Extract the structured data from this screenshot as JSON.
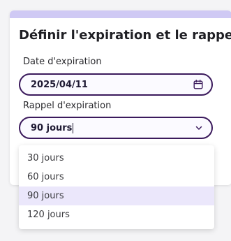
{
  "dialog": {
    "title": "Définir l'expiration et le rappel"
  },
  "expiration_date": {
    "label": "Date d'expiration",
    "value": "2025/04/11",
    "icon": "calendar-icon"
  },
  "reminder": {
    "label": "Rappel d'expiration",
    "value": "90 jours",
    "icon": "chevron-down-icon",
    "options": [
      "30 jours",
      "60 jours",
      "90 jours",
      "120 jours"
    ],
    "selected_index": 2
  },
  "colors": {
    "accent": "#3b1a5c",
    "header_strip": "#cfc9f4",
    "selected_option": "#ebe7fb"
  }
}
